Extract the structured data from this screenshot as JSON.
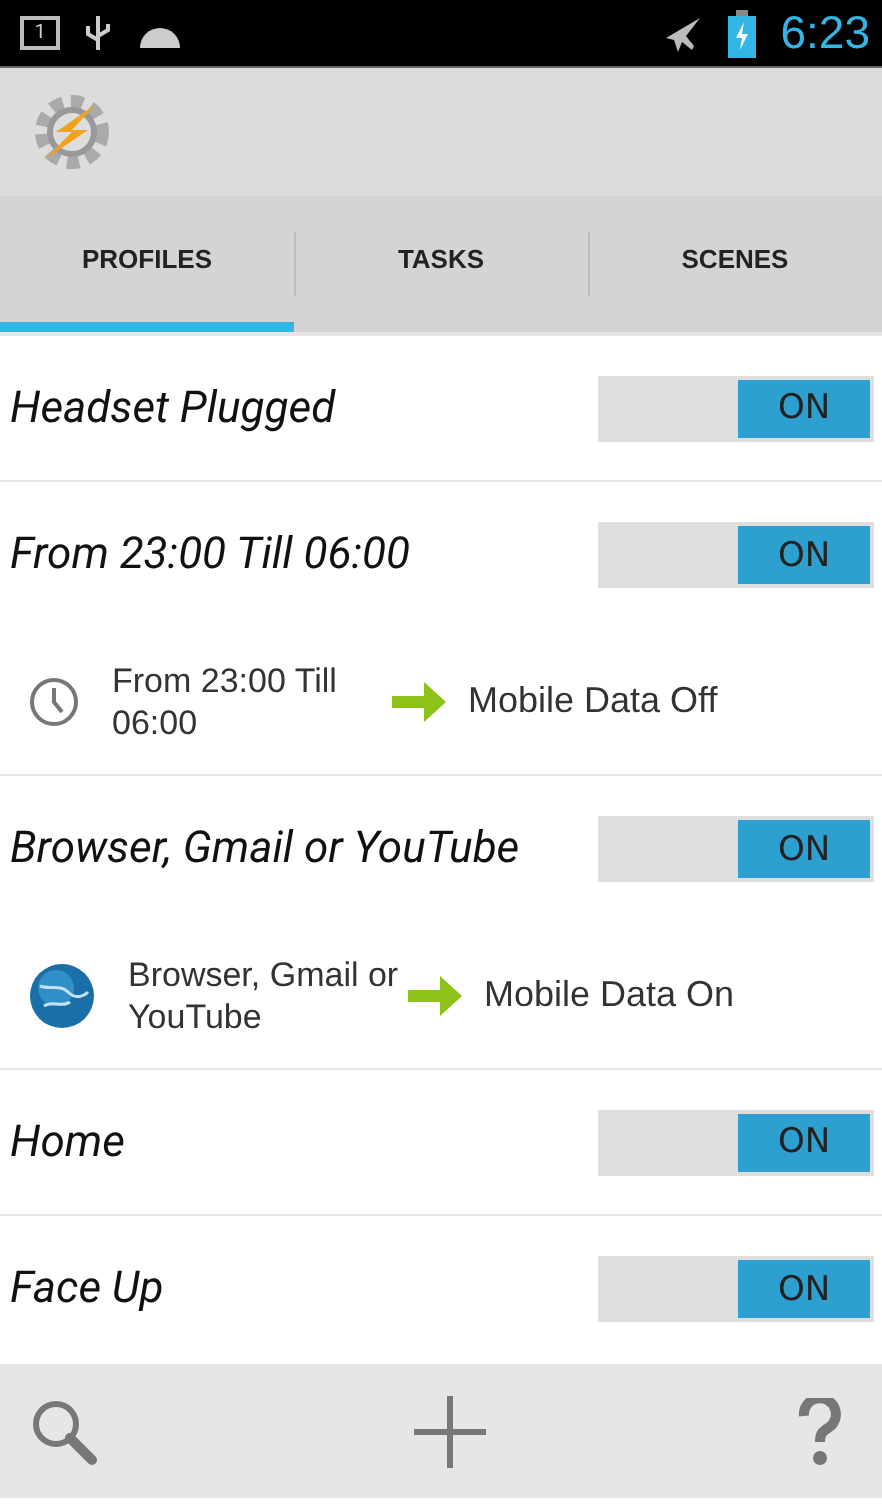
{
  "status_bar": {
    "notification_count": "1",
    "time": "6:23"
  },
  "tabs": [
    {
      "label": "PROFILES",
      "selected": true
    },
    {
      "label": "TASKS",
      "selected": false
    },
    {
      "label": "SCENES",
      "selected": false
    }
  ],
  "profiles": [
    {
      "name": "Headset Plugged",
      "on": true,
      "toggle_label": "ON"
    },
    {
      "name": "From 23:00 Till 06:00",
      "on": true,
      "toggle_label": "ON",
      "context": {
        "kind": "clock",
        "text": "From 23:00 Till 06:00",
        "task": "Mobile Data Off"
      }
    },
    {
      "name": "Browser, Gmail or YouTube",
      "on": true,
      "toggle_label": "ON",
      "context": {
        "kind": "app",
        "text": "Browser, Gmail or YouTube",
        "task": "Mobile Data On"
      }
    },
    {
      "name": "Home",
      "on": true,
      "toggle_label": "ON"
    },
    {
      "name": "Face Up",
      "on": true,
      "toggle_label": "ON"
    }
  ]
}
